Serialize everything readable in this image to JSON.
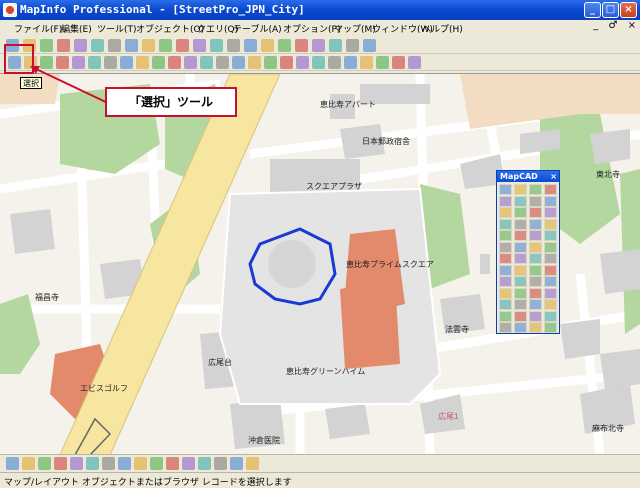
{
  "window": {
    "title": "MapInfo Professional - [StreetPro_JPN_City]",
    "buttons": [
      "_",
      "□",
      "×"
    ]
  },
  "menu": [
    "ファイル(F)",
    "編集(E)",
    "ツール(T)",
    "オブジェクト(O)",
    "クエリ(Q)",
    "テーブル(A)",
    "オプション(P)",
    "マップ(M)",
    "ウィンドウ(W)",
    "ヘルプ(H)"
  ],
  "mdi_controls": [
    "_",
    "♂",
    "×"
  ],
  "tooltip": "選択",
  "callout": "「選択」ツール",
  "map_labels": {
    "ebisu_apart": "恵比寿アパート",
    "nihon_yusei": "日本郵政宿舎",
    "square_plaza": "スクエアプラザ",
    "prime_square": "恵比寿プライムスクエア",
    "fukuju": "福昌寺",
    "hiroo_dai": "広尾台",
    "green_heim": "恵比寿グリーンハイム",
    "hokyo": "法雲寺",
    "ebisu_golf": "エビスゴルフ",
    "hiroo": "広尾1",
    "okikura": "沖倉医院",
    "azabu": "麻布北寺",
    "higashi_kita": "東北寺"
  },
  "mapcad": {
    "title": "MapCAD",
    "close": "×"
  },
  "status": "マップ/レイアウト オブジェクトまたはブラウザ レコードを選択します",
  "colors": {
    "titlebar": "#0b4bd2",
    "green": "#b4d7a0",
    "building": "#d0d0d0",
    "orange_building": "#e28a6b",
    "road_main": "#f7e6a0",
    "highlight_red": "#c8102e",
    "selection_blue": "#1a3ad6"
  }
}
